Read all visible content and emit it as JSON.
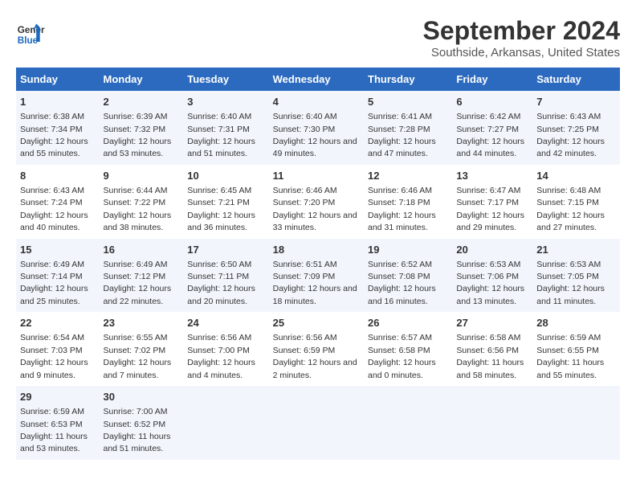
{
  "header": {
    "logo_line1": "General",
    "logo_line2": "Blue",
    "title": "September 2024",
    "subtitle": "Southside, Arkansas, United States"
  },
  "weekdays": [
    "Sunday",
    "Monday",
    "Tuesday",
    "Wednesday",
    "Thursday",
    "Friday",
    "Saturday"
  ],
  "weeks": [
    [
      {
        "day": "1",
        "sunrise": "6:38 AM",
        "sunset": "7:34 PM",
        "daylight": "12 hours and 55 minutes."
      },
      {
        "day": "2",
        "sunrise": "6:39 AM",
        "sunset": "7:32 PM",
        "daylight": "12 hours and 53 minutes."
      },
      {
        "day": "3",
        "sunrise": "6:40 AM",
        "sunset": "7:31 PM",
        "daylight": "12 hours and 51 minutes."
      },
      {
        "day": "4",
        "sunrise": "6:40 AM",
        "sunset": "7:30 PM",
        "daylight": "12 hours and 49 minutes."
      },
      {
        "day": "5",
        "sunrise": "6:41 AM",
        "sunset": "7:28 PM",
        "daylight": "12 hours and 47 minutes."
      },
      {
        "day": "6",
        "sunrise": "6:42 AM",
        "sunset": "7:27 PM",
        "daylight": "12 hours and 44 minutes."
      },
      {
        "day": "7",
        "sunrise": "6:43 AM",
        "sunset": "7:25 PM",
        "daylight": "12 hours and 42 minutes."
      }
    ],
    [
      {
        "day": "8",
        "sunrise": "6:43 AM",
        "sunset": "7:24 PM",
        "daylight": "12 hours and 40 minutes."
      },
      {
        "day": "9",
        "sunrise": "6:44 AM",
        "sunset": "7:22 PM",
        "daylight": "12 hours and 38 minutes."
      },
      {
        "day": "10",
        "sunrise": "6:45 AM",
        "sunset": "7:21 PM",
        "daylight": "12 hours and 36 minutes."
      },
      {
        "day": "11",
        "sunrise": "6:46 AM",
        "sunset": "7:20 PM",
        "daylight": "12 hours and 33 minutes."
      },
      {
        "day": "12",
        "sunrise": "6:46 AM",
        "sunset": "7:18 PM",
        "daylight": "12 hours and 31 minutes."
      },
      {
        "day": "13",
        "sunrise": "6:47 AM",
        "sunset": "7:17 PM",
        "daylight": "12 hours and 29 minutes."
      },
      {
        "day": "14",
        "sunrise": "6:48 AM",
        "sunset": "7:15 PM",
        "daylight": "12 hours and 27 minutes."
      }
    ],
    [
      {
        "day": "15",
        "sunrise": "6:49 AM",
        "sunset": "7:14 PM",
        "daylight": "12 hours and 25 minutes."
      },
      {
        "day": "16",
        "sunrise": "6:49 AM",
        "sunset": "7:12 PM",
        "daylight": "12 hours and 22 minutes."
      },
      {
        "day": "17",
        "sunrise": "6:50 AM",
        "sunset": "7:11 PM",
        "daylight": "12 hours and 20 minutes."
      },
      {
        "day": "18",
        "sunrise": "6:51 AM",
        "sunset": "7:09 PM",
        "daylight": "12 hours and 18 minutes."
      },
      {
        "day": "19",
        "sunrise": "6:52 AM",
        "sunset": "7:08 PM",
        "daylight": "12 hours and 16 minutes."
      },
      {
        "day": "20",
        "sunrise": "6:53 AM",
        "sunset": "7:06 PM",
        "daylight": "12 hours and 13 minutes."
      },
      {
        "day": "21",
        "sunrise": "6:53 AM",
        "sunset": "7:05 PM",
        "daylight": "12 hours and 11 minutes."
      }
    ],
    [
      {
        "day": "22",
        "sunrise": "6:54 AM",
        "sunset": "7:03 PM",
        "daylight": "12 hours and 9 minutes."
      },
      {
        "day": "23",
        "sunrise": "6:55 AM",
        "sunset": "7:02 PM",
        "daylight": "12 hours and 7 minutes."
      },
      {
        "day": "24",
        "sunrise": "6:56 AM",
        "sunset": "7:00 PM",
        "daylight": "12 hours and 4 minutes."
      },
      {
        "day": "25",
        "sunrise": "6:56 AM",
        "sunset": "6:59 PM",
        "daylight": "12 hours and 2 minutes."
      },
      {
        "day": "26",
        "sunrise": "6:57 AM",
        "sunset": "6:58 PM",
        "daylight": "12 hours and 0 minutes."
      },
      {
        "day": "27",
        "sunrise": "6:58 AM",
        "sunset": "6:56 PM",
        "daylight": "11 hours and 58 minutes."
      },
      {
        "day": "28",
        "sunrise": "6:59 AM",
        "sunset": "6:55 PM",
        "daylight": "11 hours and 55 minutes."
      }
    ],
    [
      {
        "day": "29",
        "sunrise": "6:59 AM",
        "sunset": "6:53 PM",
        "daylight": "11 hours and 53 minutes."
      },
      {
        "day": "30",
        "sunrise": "7:00 AM",
        "sunset": "6:52 PM",
        "daylight": "11 hours and 51 minutes."
      },
      {
        "day": "",
        "sunrise": "",
        "sunset": "",
        "daylight": ""
      },
      {
        "day": "",
        "sunrise": "",
        "sunset": "",
        "daylight": ""
      },
      {
        "day": "",
        "sunrise": "",
        "sunset": "",
        "daylight": ""
      },
      {
        "day": "",
        "sunrise": "",
        "sunset": "",
        "daylight": ""
      },
      {
        "day": "",
        "sunrise": "",
        "sunset": "",
        "daylight": ""
      }
    ]
  ]
}
